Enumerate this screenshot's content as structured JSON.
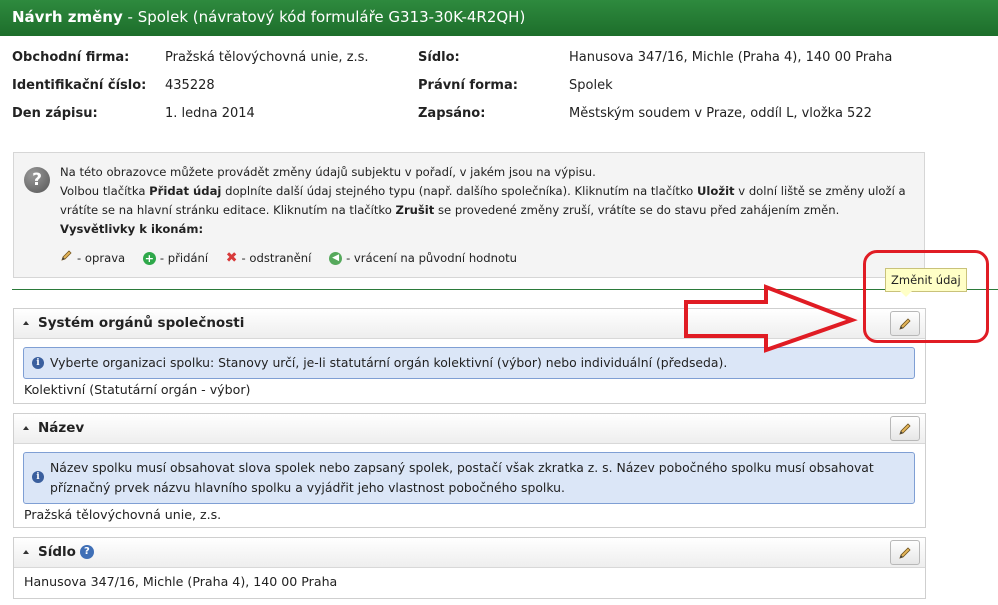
{
  "header": {
    "title_bold": "Návrh změny",
    "title_rest": " - Spolek (návratový kód formuláře G313-30K-4R2QH)"
  },
  "info": {
    "obchodni_firma_label": "Obchodní firma:",
    "obchodni_firma_value": "Pražská tělovýchovná unie, z.s.",
    "ico_label": "Identifikační číslo:",
    "ico_value": "435228",
    "den_zapisu_label": "Den zápisu:",
    "den_zapisu_value": "1. ledna 2014",
    "sidlo_label": "Sídlo:",
    "sidlo_value": "Hanusova 347/16, Michle (Praha 4), 140 00 Praha",
    "pravni_forma_label": "Právní forma:",
    "pravni_forma_value": "Spolek",
    "zapsano_label": "Zapsáno:",
    "zapsano_value": "Městským soudem v Praze, oddíl L, vložka 522"
  },
  "help": {
    "line1": "Na této obrazovce můžete provádět změny údajů subjektu v pořadí, v jakém jsou na výpisu.",
    "line2_a": "Volbou tlačítka ",
    "line2_b": "Přidat údaj",
    "line2_c": " doplníte další údaj stejného typu (např. dalšího společníka). Kliknutím na tlačítko ",
    "line2_d": "Uložit",
    "line2_e": " v dolní liště se změny uloží a vrátíte se na hlavní stránku editace. Kliknutím na tlačítko ",
    "line2_f": "Zrušit",
    "line2_g": " se provedené změny zruší, vrátíte se do stavu před zahájením změn.",
    "legend_title": "Vysvětlivky k ikonám:",
    "legend_edit": "- oprava",
    "legend_add": "- přidání",
    "legend_remove": "- odstranění",
    "legend_revert": "- vrácení na původní hodnotu"
  },
  "tooltip": "Změnit údaj",
  "sections": [
    {
      "title": "Systém orgánů společnosti",
      "note": "Vyberte organizaci spolku: Stanovy určí, je-li statutární orgán kolektivní (výbor) nebo individuální (předseda).",
      "value": "Kolektivní (Statutární orgán - výbor)"
    },
    {
      "title": "Název",
      "note": "Název spolku musí obsahovat slova spolek nebo zapsaný spolek, postačí však zkratka z. s. Název pobočného spolku musí obsahovat příznačný prvek názvu hlavního spolku a vyjádřit jeho vlastnost pobočného spolku.",
      "value": "Pražská tělovýchovná unie, z.s."
    },
    {
      "title": "Sídlo",
      "value": "Hanusova 347/16, Michle (Praha 4), 140 00 Praha"
    }
  ],
  "colors": {
    "header_green": "#1d6e2b",
    "annotation_red": "#e01c24",
    "note_blue": "#dbe6f7"
  }
}
